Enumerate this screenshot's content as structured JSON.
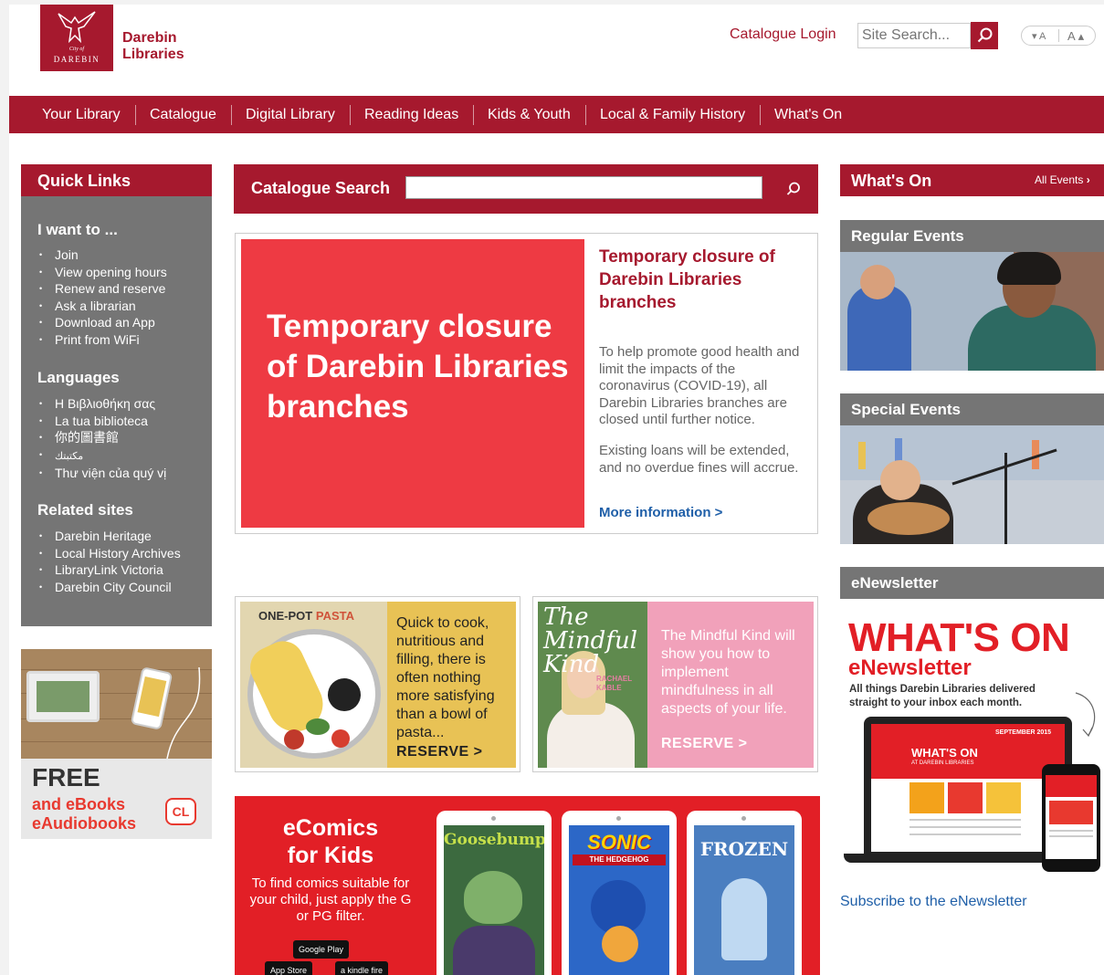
{
  "header": {
    "logo_city": "City of",
    "logo_name": "DAREBIN",
    "brand_line1": "Darebin",
    "brand_line2": "Libraries",
    "catalogue_login": "Catalogue Login",
    "site_search_placeholder": "Site Search...",
    "font_decrease": "▾ A",
    "font_increase": "A ▴"
  },
  "nav": {
    "items": [
      "Your Library",
      "Catalogue",
      "Digital Library",
      "Reading Ideas",
      "Kids & Youth",
      "Local & Family History",
      "What's On"
    ]
  },
  "quick_links": {
    "title": "Quick Links",
    "i_want_to": {
      "heading": "I want to ...",
      "items": [
        "Join",
        "View opening hours",
        "Renew and reserve",
        "Ask a librarian",
        "Download an App",
        "Print from WiFi"
      ]
    },
    "languages": {
      "heading": "Languages",
      "items": [
        "Η Βιβλιοθήκη σας",
        "La tua biblioteca",
        "你的圖書館",
        "مكتبتك",
        "Thư viện của quý vị"
      ]
    },
    "related": {
      "heading": "Related sites",
      "items": [
        "Darebin Heritage",
        "Local History Archives",
        "LibraryLink Victoria",
        "Darebin City Council"
      ]
    }
  },
  "cl_banner": {
    "free": "FREE",
    "line1": "and eBooks",
    "line2": "eAudiobooks",
    "logo": "CL"
  },
  "catalogue_search": {
    "label": "Catalogue Search"
  },
  "feature": {
    "image_text": "Temporary closure of Darebin Libraries branches",
    "title": "Temporary closure of Darebin Libraries branches",
    "para1": "To help promote good health and limit the impacts of the coronavirus (COVID-19), all Darebin Libraries branches are closed until further notice.",
    "para2": "Existing loans will be extended, and no overdue fines will accrue.",
    "more": "More information >"
  },
  "promo_pasta": {
    "book_title_a": "ONE-POT",
    "book_title_b": "PASTA",
    "text": "Quick to cook, nutritious and filling, there is often nothing more satisfying than a bowl of pasta...",
    "reserve": "RESERVE >"
  },
  "promo_mindful": {
    "book_title": "The Mindful Kind",
    "book_author": "RACHAEL KABLE",
    "text": "The Mindful Kind will show you how to implement mindfulness in all aspects of your life.",
    "reserve": "RESERVE >"
  },
  "ecomics": {
    "title_line1": "eComics",
    "title_line2": "for Kids",
    "text": "To find comics suitable for your child, just apply the G or PG filter.",
    "badge_google": "Google Play",
    "badge_apple": "App Store",
    "badge_kindle": "a kindle fire",
    "comics": [
      "Goosebumps",
      "SONIC",
      "FROZEN"
    ],
    "sonic_sub": "THE HEDGEHOG"
  },
  "whats_on": {
    "title": "What's On",
    "all_events": "All Events",
    "regular": "Regular Events",
    "special": "Special Events",
    "enewsletter": "eNewsletter"
  },
  "newsletter": {
    "big": "WHAT'S ON",
    "sub": "eNewsletter",
    "tagline": "All things Darebin Libraries delivered straight to your inbox each month.",
    "screen_title": "WHAT'S ON",
    "screen_sub": "AT DAREBIN LIBRARIES",
    "screen_date": "SEPTEMBER 2015",
    "subscribe": "Subscribe to the eNewsletter"
  },
  "colors": {
    "brand": "#a6192e",
    "grey_panel": "#757575",
    "feature_red": "#ee3a43",
    "link_blue": "#1f5fa8"
  }
}
